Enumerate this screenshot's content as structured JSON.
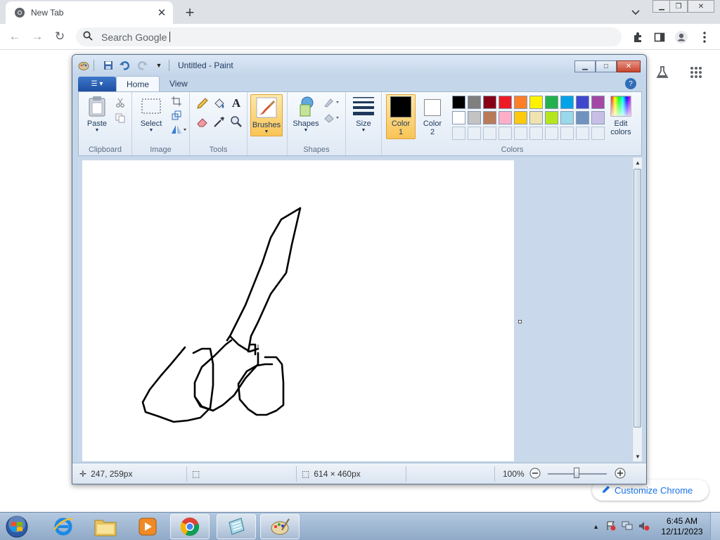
{
  "browser": {
    "tab_title": "New Tab",
    "omnibox_placeholder": "Search Google",
    "customize_label": "Customize Chrome"
  },
  "paint": {
    "window_title": "Untitled - Paint",
    "tabs": {
      "home": "Home",
      "view": "View"
    },
    "groups": {
      "clipboard": "Clipboard",
      "image": "Image",
      "tools": "Tools",
      "shapes": "Shapes",
      "colors": "Colors"
    },
    "buttons": {
      "paste": "Paste",
      "select": "Select",
      "brushes": "Brushes",
      "shapes": "Shapes",
      "size": "Size",
      "color1_line1": "Color",
      "color1_line2": "1",
      "color2_line1": "Color",
      "color2_line2": "2",
      "edit_colors_line1": "Edit",
      "edit_colors_line2": "colors"
    },
    "color1": "#000000",
    "color2": "#ffffff",
    "palette_row1": [
      "#000000",
      "#7f7f7f",
      "#880015",
      "#ed1c24",
      "#ff7f27",
      "#fff200",
      "#22b14c",
      "#00a2e8",
      "#3f48cc",
      "#a349a4"
    ],
    "palette_row2": [
      "#ffffff",
      "#c3c3c3",
      "#b97a57",
      "#ffaec9",
      "#ffc90e",
      "#efe4b0",
      "#b5e61d",
      "#99d9ea",
      "#7092be",
      "#c8bfe7"
    ],
    "status": {
      "cursor_pos": "247, 259px",
      "canvas_size": "614 × 460px",
      "zoom": "100%"
    }
  },
  "taskbar": {
    "time": "6:45 AM",
    "date": "12/11/2023"
  }
}
